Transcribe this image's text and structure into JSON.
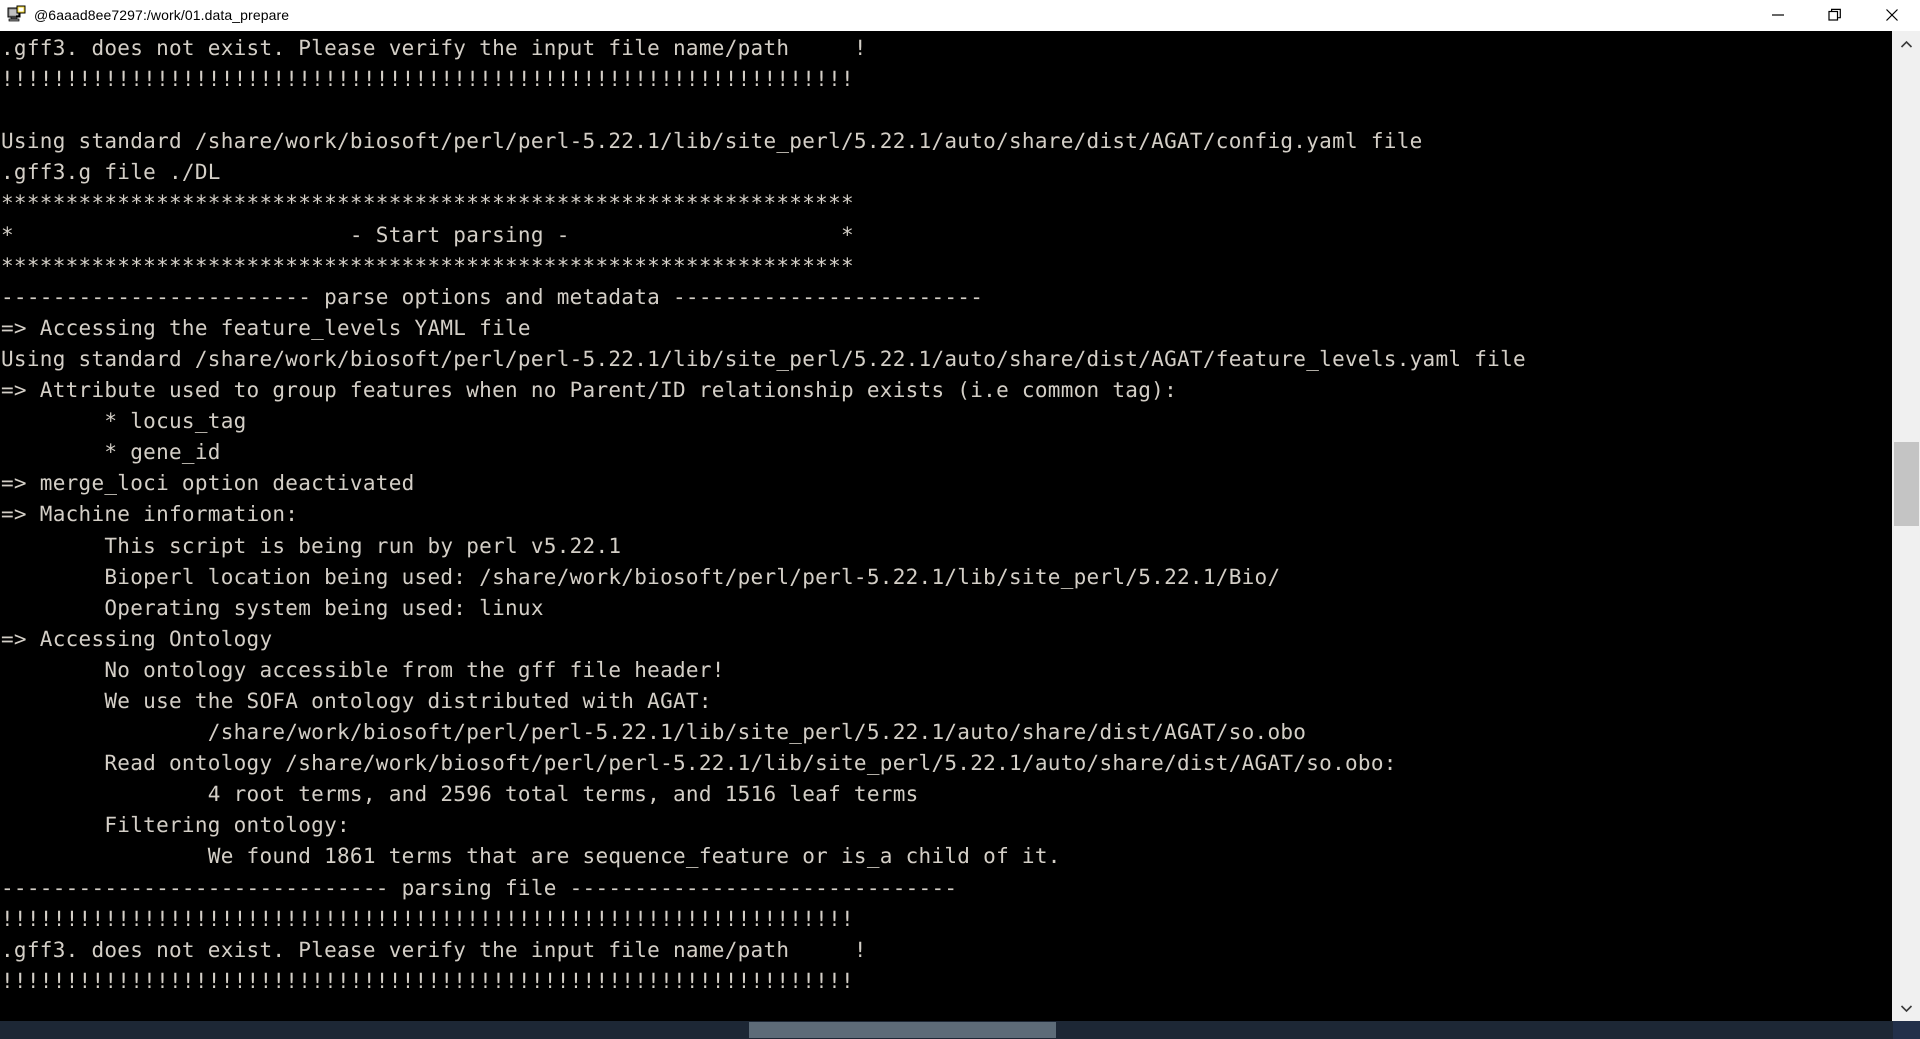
{
  "window": {
    "title": "@6aaad8ee7297:/work/01.data_prepare",
    "icon": "terminal-app-icon",
    "controls": [
      {
        "name": "minimize-button",
        "glyph": "minimize-icon",
        "label": "Minimize"
      },
      {
        "name": "restore-button",
        "glyph": "restore-icon",
        "label": "Restore"
      },
      {
        "name": "close-button",
        "glyph": "close-icon",
        "label": "Close"
      }
    ]
  },
  "terminal": {
    "foreground_color": "#d4cfc7",
    "background_color": "#000000",
    "font_size_px": 21,
    "lines": [
      ".gff3. does not exist. Please verify the input file name/path     !",
      "!!!!!!!!!!!!!!!!!!!!!!!!!!!!!!!!!!!!!!!!!!!!!!!!!!!!!!!!!!!!!!!!!!",
      "",
      "Using standard /share/work/biosoft/perl/perl-5.22.1/lib/site_perl/5.22.1/auto/share/dist/AGAT/config.yaml file",
      ".gff3.g file ./DL",
      "******************************************************************",
      "*                          - Start parsing -                     *",
      "******************************************************************",
      "------------------------ parse options and metadata ------------------------",
      "=> Accessing the feature_levels YAML file",
      "Using standard /share/work/biosoft/perl/perl-5.22.1/lib/site_perl/5.22.1/auto/share/dist/AGAT/feature_levels.yaml file",
      "=> Attribute used to group features when no Parent/ID relationship exists (i.e common tag):",
      "        * locus_tag",
      "        * gene_id",
      "=> merge_loci option deactivated",
      "=> Machine information:",
      "        This script is being run by perl v5.22.1",
      "        Bioperl location being used: /share/work/biosoft/perl/perl-5.22.1/lib/site_perl/5.22.1/Bio/",
      "        Operating system being used: linux",
      "=> Accessing Ontology",
      "        No ontology accessible from the gff file header!",
      "        We use the SOFA ontology distributed with AGAT:",
      "                /share/work/biosoft/perl/perl-5.22.1/lib/site_perl/5.22.1/auto/share/dist/AGAT/so.obo",
      "        Read ontology /share/work/biosoft/perl/perl-5.22.1/lib/site_perl/5.22.1/auto/share/dist/AGAT/so.obo:",
      "                4 root terms, and 2596 total terms, and 1516 leaf terms",
      "        Filtering ontology:",
      "                We found 1861 terms that are sequence_feature or is_a child of it.",
      "------------------------------ parsing file ------------------------------",
      "!!!!!!!!!!!!!!!!!!!!!!!!!!!!!!!!!!!!!!!!!!!!!!!!!!!!!!!!!!!!!!!!!!",
      ".gff3. does not exist. Please verify the input file name/path     !",
      "!!!!!!!!!!!!!!!!!!!!!!!!!!!!!!!!!!!!!!!!!!!!!!!!!!!!!!!!!!!!!!!!!!"
    ]
  },
  "scrollbars": {
    "vertical": {
      "name": "vertical-scrollbar",
      "up_arrow": "chevron-up-icon",
      "down_arrow": "chevron-down-icon",
      "thumb_top_pct": 41,
      "thumb_height_pct": 9
    },
    "horizontal": {
      "name": "horizontal-scrollbar",
      "thumb_left_pct": 39,
      "thumb_width_pct": 16,
      "track_color": "#1d2735",
      "thumb_color": "#5d6b78"
    }
  }
}
